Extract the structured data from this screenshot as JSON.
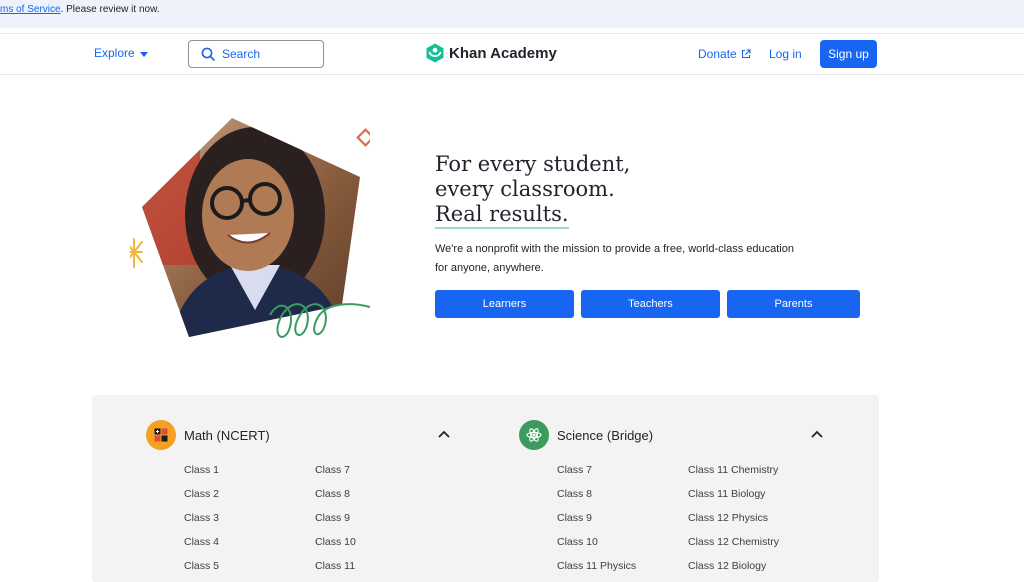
{
  "banner": {
    "link_text": "ms of Service",
    "suffix": ". Please review it now."
  },
  "nav": {
    "explore_label": "Explore",
    "search_label": "Search",
    "brand": "Khan Academy",
    "donate_label": "Donate",
    "login_label": "Log in",
    "signup_label": "Sign up",
    "accent": "#1865f2",
    "logo_color": "#14bf96"
  },
  "hero": {
    "headline": [
      "For every student,",
      "every classroom.",
      "Real results."
    ],
    "subtext": [
      "We're a nonprofit with the mission to provide a free, world-class education",
      "for anyone, anywhere."
    ],
    "buttons": [
      "Learners",
      "Teachers",
      "Parents"
    ]
  },
  "courses": [
    {
      "title": "Math (NCERT)",
      "icon": "math-icon",
      "icon_color": "#f3a023",
      "links_col1": [
        "Class 1",
        "Class 2",
        "Class 3",
        "Class 4",
        "Class 5"
      ],
      "links_col2": [
        "Class 7",
        "Class 8",
        "Class 9",
        "Class 10",
        "Class 11"
      ]
    },
    {
      "title": "Science (Bridge)",
      "icon": "science-icon",
      "icon_color": "#3d9b5f",
      "links_col1": [
        "Class 7",
        "Class 8",
        "Class 9",
        "Class 10",
        "Class 11 Physics"
      ],
      "links_col2": [
        "Class 11 Chemistry",
        "Class 11 Biology",
        "Class 12 Physics",
        "Class 12 Chemistry",
        "Class 12 Biology"
      ]
    }
  ]
}
